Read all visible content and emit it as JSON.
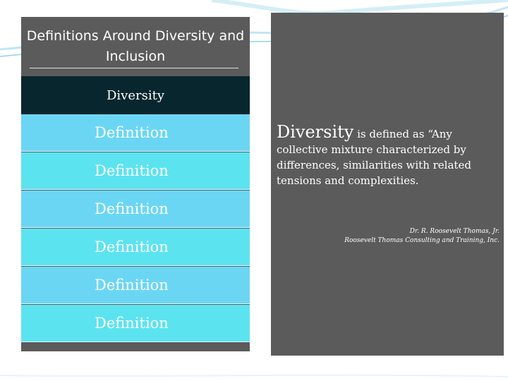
{
  "title": "Definitions Around Diversity and Inclusion",
  "table": {
    "header": "Diversity",
    "rows": [
      "Definition",
      "Definition",
      "Definition",
      "Definition",
      "Definition",
      "Definition"
    ]
  },
  "definition": {
    "term": "Diversity",
    "intro": " is defined as “Any",
    "rest": "collective mixture characterized by differences, similarities with related tensions and complexities."
  },
  "citation": {
    "author": "Dr. R. Roosevelt Thomas, Jr.",
    "organization": "Roosevelt Thomas Consulting and Training, Inc."
  },
  "colors": {
    "panel": "#5b5b5b",
    "header": "#08262d",
    "row_a": "#6bd6f4",
    "row_b": "#5ce3f0",
    "accent_lines": "#8fd3ea"
  }
}
